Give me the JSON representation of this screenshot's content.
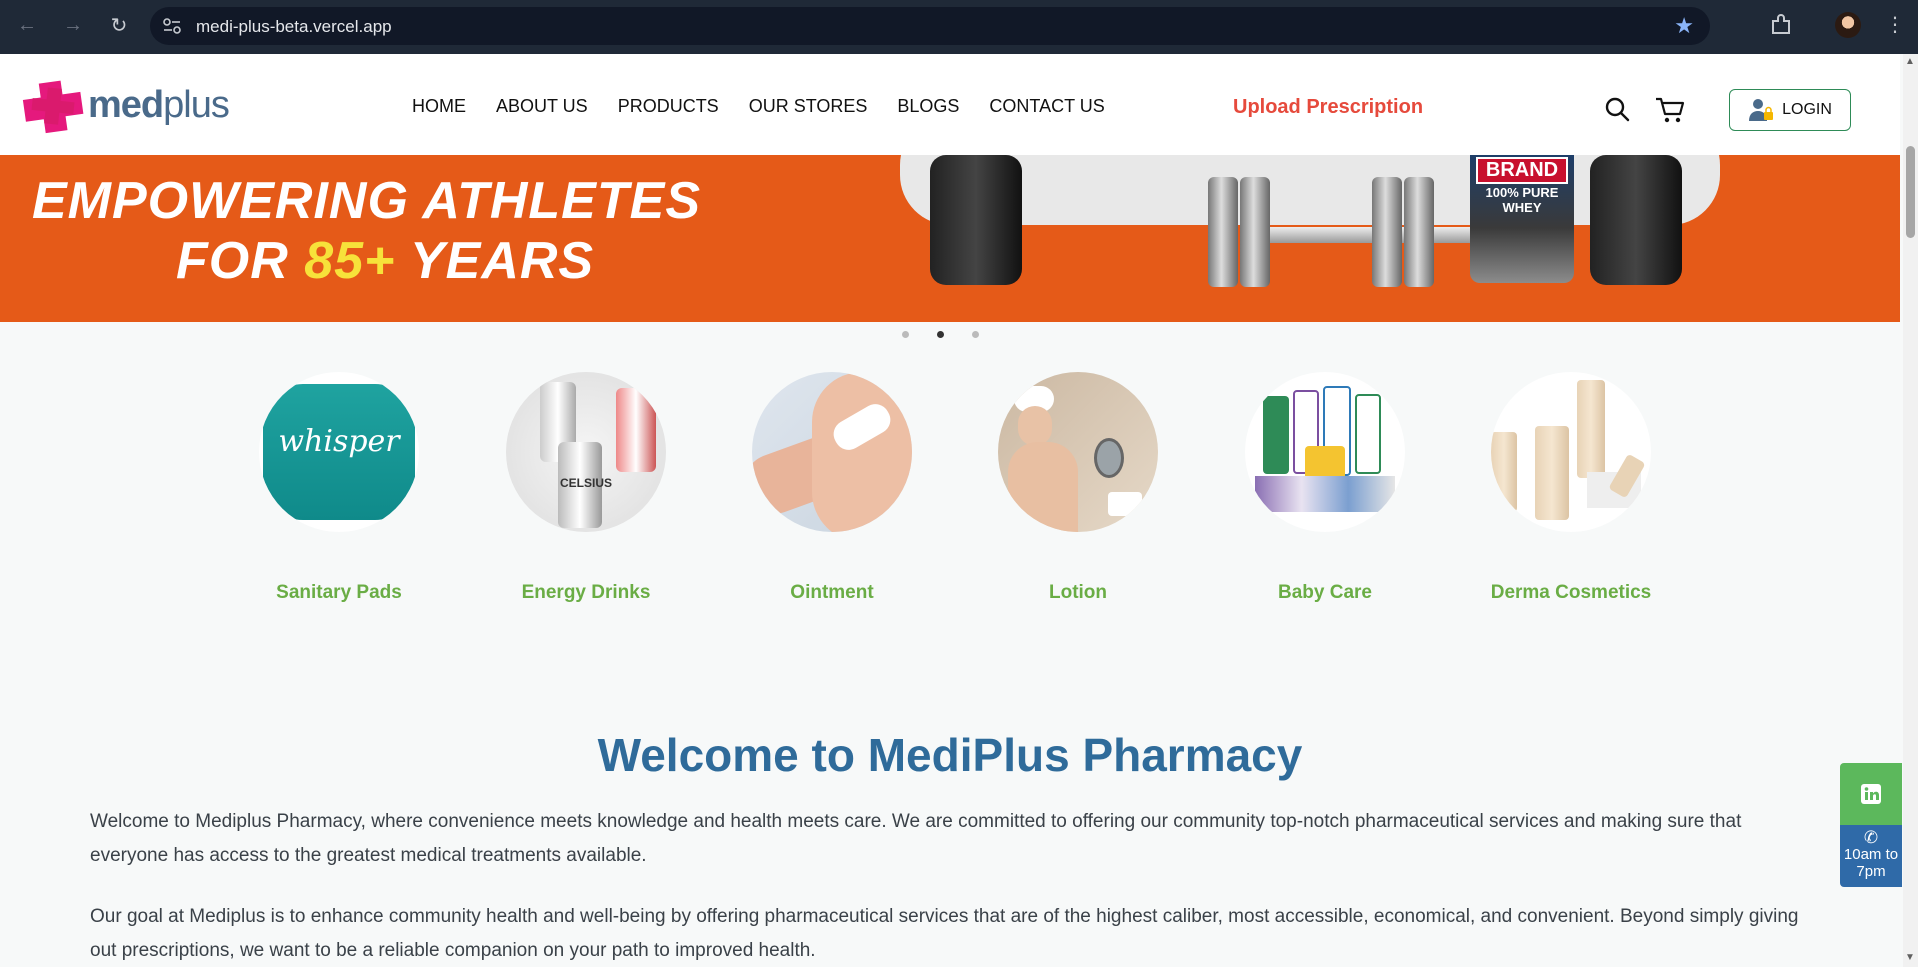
{
  "browser": {
    "url": "medi-plus-beta.vercel.app",
    "back_icon": "arrow-left-icon",
    "forward_icon": "arrow-right-icon",
    "reload_icon": "reload-icon"
  },
  "header": {
    "logo_text_bold": "med",
    "logo_text_light": "plus",
    "nav": [
      "HOME",
      "ABOUT US",
      "PRODUCTS",
      "OUR STORES",
      "BLOGS",
      "CONTACT US"
    ],
    "upload_label": "Upload Prescription",
    "login_label": "LOGIN",
    "upload_color": "#e64a3c",
    "login_border_color": "#2e8b57"
  },
  "hero": {
    "line1": "EMPOWERING ATHLETES",
    "line2_a": "FOR ",
    "line2_b": "85+",
    "line2_c": " YEARS",
    "brand_tag": "BRAND",
    "whey_tag": "100% PURE WHEY",
    "bg_color": "#e55a18",
    "slide_count": 3,
    "active_slide": 2
  },
  "categories": [
    {
      "label": "Sanitary Pads",
      "product_text": "whisper"
    },
    {
      "label": "Energy Drinks",
      "product_text": "CELSIUS"
    },
    {
      "label": "Ointment"
    },
    {
      "label": "Lotion"
    },
    {
      "label": "Baby Care"
    },
    {
      "label": "Derma Cosmetics"
    }
  ],
  "welcome": {
    "title": "Welcome to MediPlus Pharmacy",
    "p1": "Welcome to Mediplus Pharmacy, where convenience meets knowledge and health meets care. We are committed to offering our community top-notch pharmaceutical services and making sure that everyone has access to the greatest medical treatments available.",
    "p2": "Our goal at Mediplus is to enhance community health and well-being by offering pharmaceutical services that are of the highest caliber, most accessible, economical, and convenient. Beyond simply giving out prescriptions, we want to be a reliable companion on your path to improved health."
  },
  "side_widget": {
    "hours": "10am to 7pm"
  },
  "colors": {
    "title_blue": "#2f6b9a",
    "category_green": "#6aad45",
    "linkedin_green": "#5cb85c",
    "phone_blue": "#2f6aa8"
  }
}
